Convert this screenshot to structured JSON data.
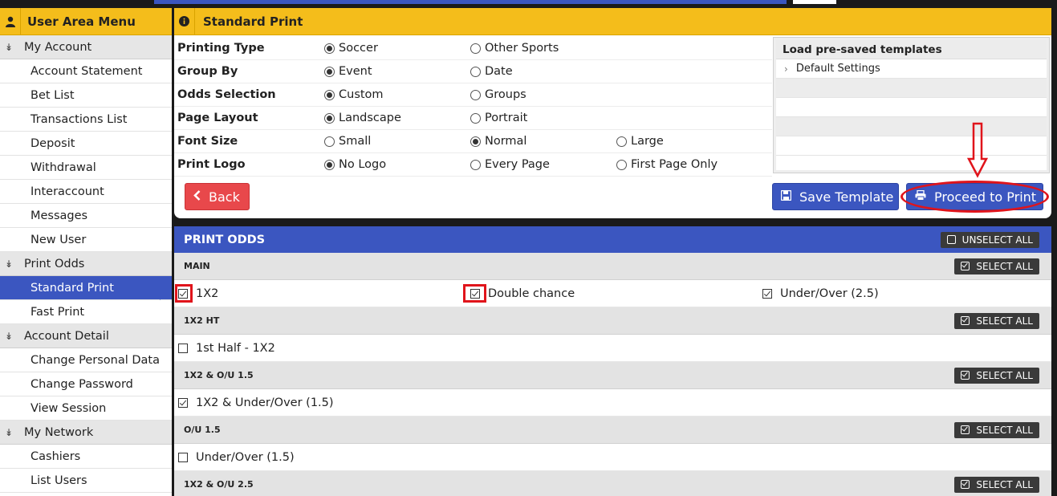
{
  "sidebar": {
    "title": "User Area Menu",
    "sections": [
      {
        "label": "My Account",
        "items": [
          "Account Statement",
          "Bet List",
          "Transactions List",
          "Deposit",
          "Withdrawal",
          "Interaccount",
          "Messages",
          "New User"
        ]
      },
      {
        "label": "Print Odds",
        "items": [
          "Standard Print",
          "Fast Print"
        ]
      },
      {
        "label": "Account Detail",
        "items": [
          "Change Personal Data",
          "Change Password",
          "View Session"
        ]
      },
      {
        "label": "My Network",
        "items": [
          "Cashiers",
          "List Users"
        ]
      }
    ],
    "active_item": "Standard Print"
  },
  "panel": {
    "title": "Standard Print",
    "options": [
      {
        "label": "Printing Type",
        "choices": [
          "Soccer",
          "Other Sports"
        ],
        "selected": "Soccer"
      },
      {
        "label": "Group By",
        "choices": [
          "Event",
          "Date"
        ],
        "selected": "Event"
      },
      {
        "label": "Odds Selection",
        "choices": [
          "Custom",
          "Groups"
        ],
        "selected": "Custom"
      },
      {
        "label": "Page Layout",
        "choices": [
          "Landscape",
          "Portrait"
        ],
        "selected": "Landscape"
      },
      {
        "label": "Font Size",
        "choices": [
          "Small",
          "Normal",
          "Large"
        ],
        "selected": "Normal"
      },
      {
        "label": "Print Logo",
        "choices": [
          "No Logo",
          "Every Page",
          "First Page Only"
        ],
        "selected": "No Logo"
      }
    ],
    "templates": {
      "header": "Load pre-saved templates",
      "items": [
        "Default Settings"
      ]
    },
    "buttons": {
      "back": "Back",
      "save_template": "Save Template",
      "proceed": "Proceed to Print"
    }
  },
  "odds": {
    "title": "PRINT ODDS",
    "unselect_all": "UNSELECT ALL",
    "select_all": "SELECT ALL",
    "groups": [
      {
        "name": "MAIN",
        "markets": [
          {
            "label": "1X2",
            "checked": true
          },
          {
            "label": "Double chance",
            "checked": true
          },
          {
            "label": "Under/Over (2.5)",
            "checked": true
          }
        ]
      },
      {
        "name": "1X2 HT",
        "markets": [
          {
            "label": "1st Half - 1X2",
            "checked": false
          }
        ]
      },
      {
        "name": "1X2 & O/U 1.5",
        "markets": [
          {
            "label": "1X2 & Under/Over (1.5)",
            "checked": true
          }
        ]
      },
      {
        "name": "O/U 1.5",
        "markets": [
          {
            "label": "Under/Over (1.5)",
            "checked": false
          }
        ]
      },
      {
        "name": "1X2 & O/U 2.5",
        "markets": []
      }
    ]
  },
  "colors": {
    "accent_yellow": "#f4bd1b",
    "primary_blue": "#3b56c0",
    "danger_red": "#e8484b",
    "annotation_red": "#e0141b"
  }
}
